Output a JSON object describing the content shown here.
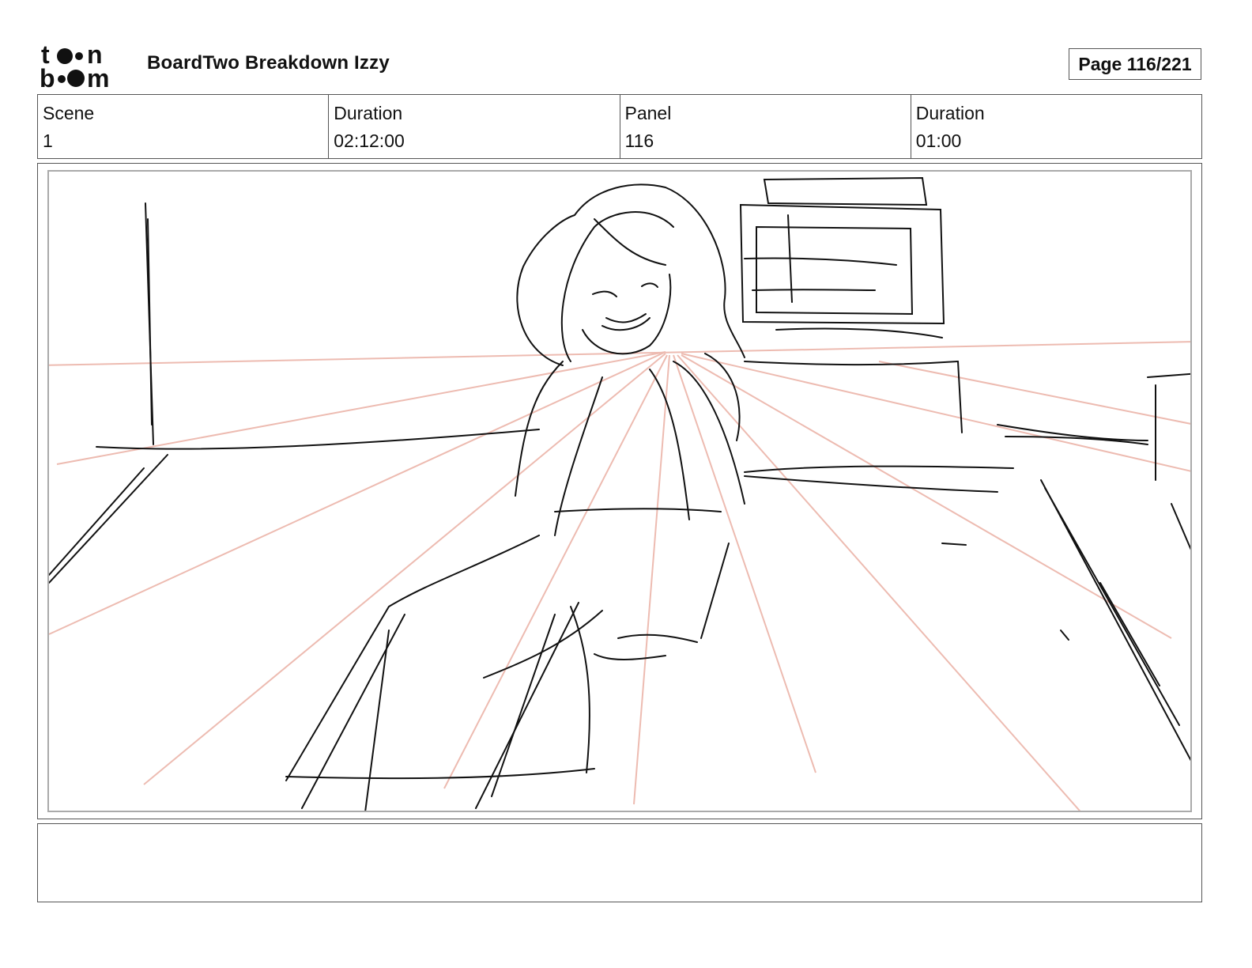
{
  "logo": {
    "line1": "toon",
    "line2": "boom",
    "icon": "toon-boom-logo"
  },
  "header": {
    "title": "BoardTwo Breakdown Izzy",
    "page": "Page 116/221"
  },
  "info": {
    "scene_label": "Scene",
    "scene_value": "1",
    "scene_duration_label": "Duration",
    "scene_duration_value": "02:12:00",
    "panel_label": "Panel",
    "panel_value": "116",
    "panel_duration_label": "Duration",
    "panel_duration_value": "01:00"
  },
  "panel": {
    "image": "storyboard-sketch-girl-sitting-in-room"
  },
  "notes": {
    "text": ""
  },
  "colors": {
    "sketch": "#111111",
    "perspective": "#eab0a4",
    "border": "#555555"
  }
}
